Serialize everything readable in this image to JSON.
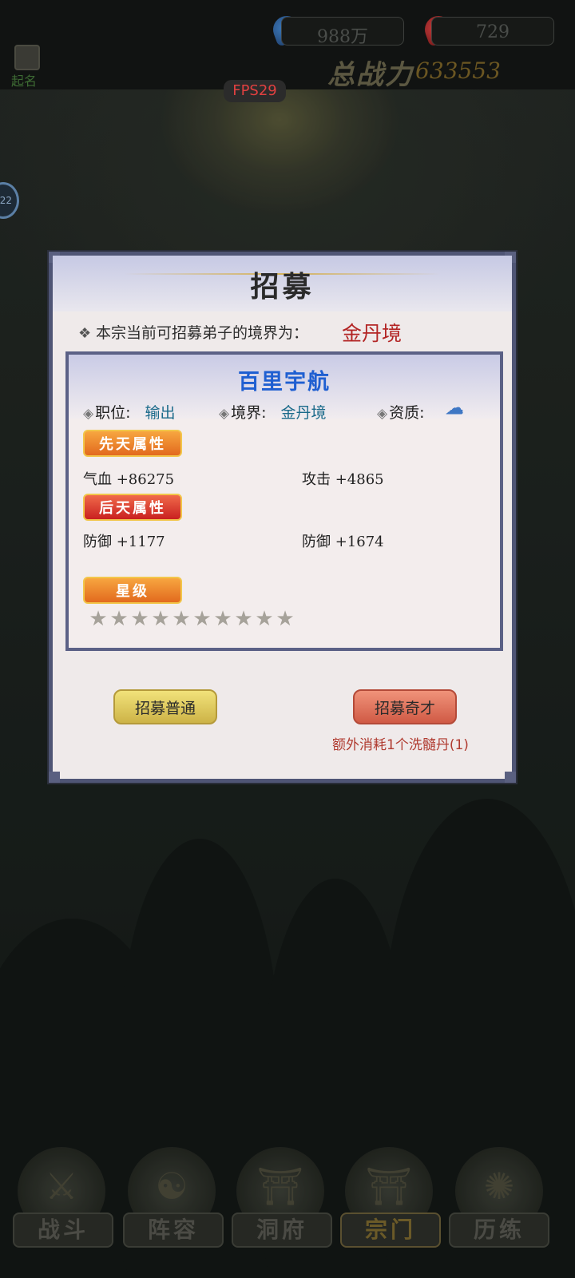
{
  "topbar": {
    "currency_blue": "988万",
    "currency_red": "729",
    "power_label": "总战力",
    "power_value": "633553",
    "avatar_label": "起名",
    "fps": "FPS29",
    "side_badge": "22"
  },
  "modal": {
    "title": "招募",
    "realm_prompt": "本宗当前可招募弟子的境界为：",
    "realm_value": "金丹境",
    "card": {
      "name": "百里宇航",
      "role_label": "职位:",
      "role_value": "输出",
      "realm_label": "境界:",
      "realm_value": "金丹境",
      "aptitude_label": "资质:",
      "aptitude_icon": "aptitude-badge-icon",
      "innate_tag": "先天属性",
      "innate_attrs": [
        "气血 +86275",
        "攻击 +4865"
      ],
      "acquired_tag": "后天属性",
      "acquired_attrs": [
        "防御 +1177",
        "防御 +1674"
      ],
      "star_tag": "星级",
      "star_count": 0,
      "star_total": 10
    },
    "buttons": {
      "normal": "招募普通",
      "elite": "招募奇才"
    },
    "elite_cost": "额外消耗1个洗髓丹(1)"
  },
  "nav": {
    "tabs": [
      "战斗",
      "阵容",
      "洞府",
      "宗门",
      "历练"
    ],
    "active_index": 3
  },
  "colors": {
    "title_blue": "#1f5fd1",
    "realm_red": "#b32525",
    "modal_border": "#4f5575"
  }
}
